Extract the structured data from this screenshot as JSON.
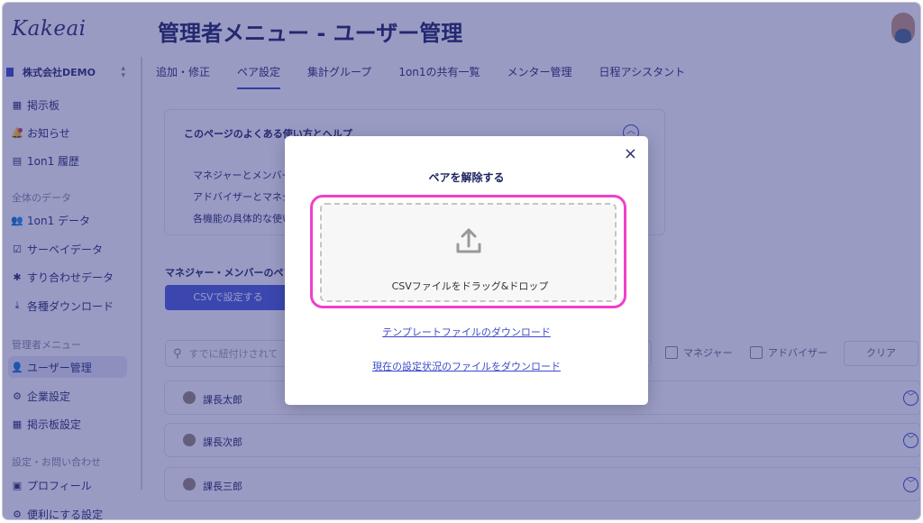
{
  "sidebar": {
    "logo": "Kakeai",
    "company": "株式会社DEMO",
    "items_top": [
      {
        "label": "掲示板",
        "icon": "board-icon"
      },
      {
        "label": "お知らせ",
        "icon": "bell-icon"
      },
      {
        "label": "1on1 履歴",
        "icon": "history-icon"
      }
    ],
    "section_data": "全体のデータ",
    "items_data": [
      {
        "label": "1on1 データ",
        "icon": "people-icon"
      },
      {
        "label": "サーベイデータ",
        "icon": "survey-icon"
      },
      {
        "label": "すり合わせデータ",
        "icon": "puzzle-icon"
      },
      {
        "label": "各種ダウンロード",
        "icon": "download-icon"
      }
    ],
    "section_admin": "管理者メニュー",
    "items_admin": [
      {
        "label": "ユーザー管理",
        "icon": "user-admin-icon",
        "active": true
      },
      {
        "label": "企業設定",
        "icon": "company-settings-icon"
      },
      {
        "label": "掲示板設定",
        "icon": "board-settings-icon"
      }
    ],
    "section_settings": "設定・お問い合わせ",
    "items_settings": [
      {
        "label": "プロフィール",
        "icon": "profile-icon"
      },
      {
        "label": "便利にする設定",
        "icon": "gear-icon"
      }
    ]
  },
  "header": {
    "title": "管理者メニュー - ユーザー管理"
  },
  "tabs": [
    {
      "label": "追加・修正"
    },
    {
      "label": "ペア設定",
      "active": true
    },
    {
      "label": "集計グループ"
    },
    {
      "label": "1on1の共有一覧"
    },
    {
      "label": "メンター管理"
    },
    {
      "label": "日程アシスタント"
    }
  ],
  "help": {
    "title": "このページのよくある使い方とヘルプ",
    "lines": [
      "マネジャーとメンバー",
      "アドバイザーとマネジ",
      "各機能の具体的な使い"
    ]
  },
  "pair_section": {
    "title": "マネジャー・メンバーのペア",
    "csv_button": "CSVで設定する"
  },
  "search": {
    "placeholder": "すでに紐付けされて"
  },
  "filters": {
    "manager": "マネジャー",
    "advisor": "アドバイザー",
    "clear": "クリア"
  },
  "rows": [
    {
      "name": "課長太郎"
    },
    {
      "name": "課長次郎"
    },
    {
      "name": "課長三郎"
    }
  ],
  "modal": {
    "title": "ペアを解除する",
    "close": "×",
    "drop_text": "CSVファイルをドラッグ&ドロップ",
    "template_link": "テンプレートファイルのダウンロード",
    "current_link": "現在の設定状況のファイルをダウンロード"
  },
  "colors": {
    "accent": "#3b4bc8",
    "highlight": "#f040c8",
    "overlay": "#2a2e82"
  }
}
